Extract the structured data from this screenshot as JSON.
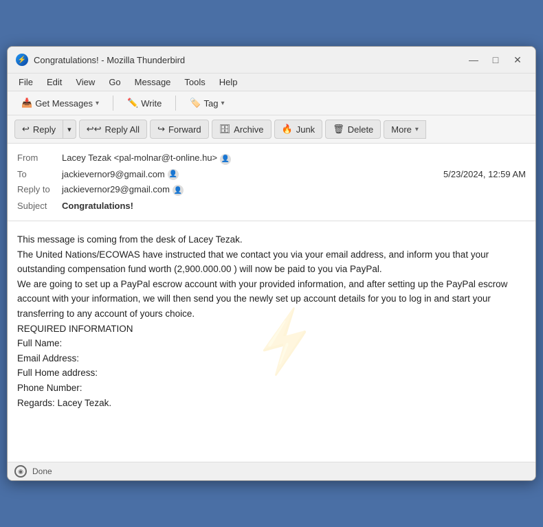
{
  "window": {
    "title": "Congratulations! - Mozilla Thunderbird",
    "icon": "🔵",
    "controls": {
      "minimize": "—",
      "maximize": "□",
      "close": "✕"
    }
  },
  "menubar": {
    "items": [
      "File",
      "Edit",
      "View",
      "Go",
      "Message",
      "Tools",
      "Help"
    ]
  },
  "toolbar": {
    "get_messages_label": "Get Messages",
    "write_label": "Write",
    "tag_label": "Tag"
  },
  "actions": {
    "reply_label": "Reply",
    "reply_all_label": "Reply All",
    "forward_label": "Forward",
    "archive_label": "Archive",
    "junk_label": "Junk",
    "delete_label": "Delete",
    "more_label": "More"
  },
  "email": {
    "from_label": "From",
    "from_value": "Lacey Tezak <pal-molnar@t-online.hu>",
    "to_label": "To",
    "to_value": "jackievernor9@gmail.com",
    "date_value": "5/23/2024, 12:59 AM",
    "reply_to_label": "Reply to",
    "reply_to_value": "jackievernor29@gmail.com",
    "subject_label": "Subject",
    "subject_value": "Congratulations!",
    "body": "This message is coming from the desk of Lacey Tezak.\nThe United Nations/ECOWAS have instructed that we contact you via your email address, and inform you that your outstanding compensation fund worth (2,900.000.00 ) will now be paid to you via PayPal.\nWe are going to set up a PayPal escrow account with your provided information, and after setting up the PayPal escrow account with your information, we will then send you the newly set up account details for you to log in and start your transferring to any account of yours choice.\nREQUIRED INFORMATION\nFull Name:\nEmail Address:\nFull Home address:\nPhone Number:\nRegards: Lacey Tezak."
  },
  "statusbar": {
    "status_label": "Done",
    "icon": "◉"
  }
}
